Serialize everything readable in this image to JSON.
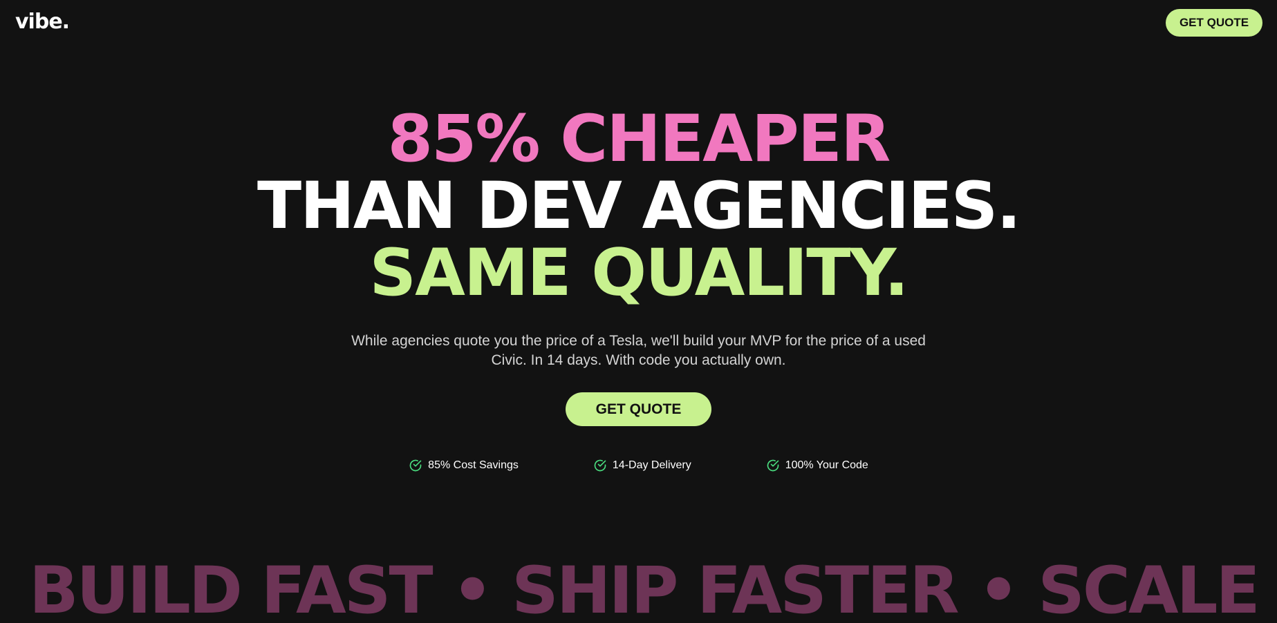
{
  "header": {
    "logo": "vibe.",
    "cta_label": "GET QUOTE"
  },
  "hero": {
    "headline_line1": "85% CHEAPER",
    "headline_line2": "THAN DEV AGENCIES.",
    "headline_line3": "SAME QUALITY.",
    "subtext": "While agencies quote you the price of a Tesla, we'll build your MVP for the price of a used Civic. In 14 days. With code you actually own.",
    "cta_label": "GET QUOTE"
  },
  "features": [
    {
      "label": "85% Cost Savings",
      "icon": "check-circle-icon"
    },
    {
      "label": "14-Day Delivery",
      "icon": "check-circle-icon"
    },
    {
      "label": "100% Your Code",
      "icon": "check-circle-icon"
    }
  ],
  "marquee": {
    "text": "BUILD FAST • SHIP FASTER • SCALE SM"
  },
  "colors": {
    "background": "#121212",
    "accent_green": "#c8f18f",
    "accent_pink": "#f178bf",
    "marquee": "#6d3456",
    "check": "#4ade80"
  }
}
